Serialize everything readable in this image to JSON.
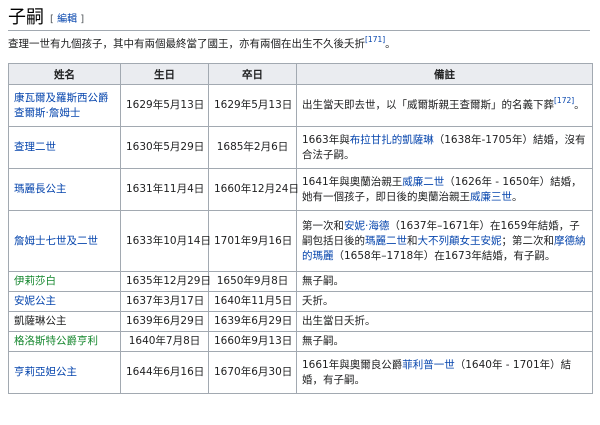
{
  "section": {
    "title": "子嗣",
    "edit_open": "[ ",
    "edit_label": "編輯",
    "edit_close": " ]"
  },
  "intro": {
    "text": "查理一世有九個孩子，其中有兩個最終當了國王，亦有兩個在出生不久後夭折",
    "ref": "[171]",
    "end": "。"
  },
  "table": {
    "headers": [
      "姓名",
      "生日",
      "卒日",
      "備註"
    ],
    "rows": [
      {
        "name": "康瓦爾及羅斯西公爵查爾斯·詹姆士",
        "birth": "1629年5月13日",
        "death": "1629年5月13日",
        "note_parts": [
          {
            "t": "出生當天即去世，以「威爾斯親王查爾斯」的名義下葬"
          },
          {
            "t": "[172]",
            "sup": true
          },
          {
            "t": "。"
          }
        ]
      },
      {
        "name": "查理二世",
        "birth": "1630年5月29日",
        "death": "1685年2月6日",
        "note_parts": [
          {
            "t": "1663年與"
          },
          {
            "t": "布拉甘扎的凱薩琳",
            "link": true
          },
          {
            "t": "（1638年-1705年）結婚，沒有合法子嗣。"
          }
        ]
      },
      {
        "name": "瑪麗長公主",
        "birth": "1631年11月4日",
        "death": "1660年12月24日",
        "note_parts": [
          {
            "t": "1641年與奧蘭治親王"
          },
          {
            "t": "威廉二世",
            "link": true
          },
          {
            "t": "（1626年 - 1650年）結婚，她有一個孩子，即日後的奧蘭治親王"
          },
          {
            "t": "威廉三世",
            "link": true
          },
          {
            "t": "。"
          }
        ]
      },
      {
        "name": "詹姆士七世及二世",
        "birth": "1633年10月14日",
        "death": "1701年9月16日",
        "note_parts": [
          {
            "t": "第一次和"
          },
          {
            "t": "安妮·海德",
            "link": true
          },
          {
            "t": "（1637年–1671年）在1659年結婚，子嗣包括日後的"
          },
          {
            "t": "瑪麗二世",
            "link": true
          },
          {
            "t": "和"
          },
          {
            "t": "大不列顛女王安妮",
            "link": true
          },
          {
            "t": "；第二次和"
          },
          {
            "t": "摩德納的瑪麗",
            "link": true
          },
          {
            "t": "（1658年–1718年）在1673年結婚，有子嗣。"
          }
        ]
      },
      {
        "name": "伊莉莎白",
        "birth": "1635年12月29日",
        "death": "1650年9月8日",
        "note_parts": [
          {
            "t": "無子嗣。"
          }
        ]
      },
      {
        "name": "安妮公主",
        "birth": "1637年3月17日",
        "death": "1640年11月5日",
        "note_parts": [
          {
            "t": "夭折。"
          }
        ]
      },
      {
        "name": "凱薩琳公主",
        "birth": "1639年6月29日",
        "death": "1639年6月29日",
        "note_parts": [
          {
            "t": "出生當日夭折。"
          }
        ]
      },
      {
        "name": "格洛斯特公爵亨利",
        "birth": "1640年7月8日",
        "death": "1660年9月13日",
        "note_parts": [
          {
            "t": "無子嗣。"
          }
        ]
      },
      {
        "name": "亨莉亞妲公主",
        "birth": "1644年6月16日",
        "death": "1670年6月30日",
        "note_parts": [
          {
            "t": "1661年與奧爾良公爵"
          },
          {
            "t": "菲利普一世",
            "link": true
          },
          {
            "t": "（1640年 - 1701年）結婚，有子嗣。"
          }
        ]
      }
    ]
  }
}
